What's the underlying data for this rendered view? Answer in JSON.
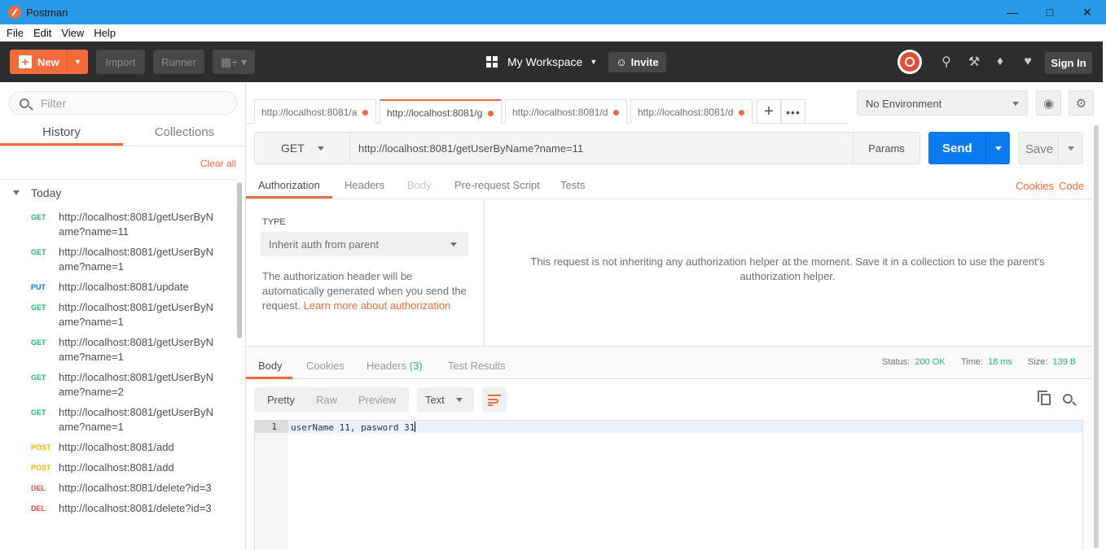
{
  "window": {
    "title": "Postman"
  },
  "menu": [
    "File",
    "Edit",
    "View",
    "Help"
  ],
  "header": {
    "new_label": "New",
    "import_label": "Import",
    "runner_label": "Runner",
    "workspace_label": "My Workspace",
    "invite_label": "Invite",
    "signin_label": "Sign In"
  },
  "sidebar": {
    "filter_placeholder": "Filter",
    "tabs": [
      "History",
      "Collections"
    ],
    "clear_all": "Clear all",
    "group_label": "Today",
    "history": [
      {
        "method": "GET",
        "url": "http://localhost:8081/getUserByName?name=11"
      },
      {
        "method": "GET",
        "url": "http://localhost:8081/getUserByName?name=1"
      },
      {
        "method": "PUT",
        "url": "http://localhost:8081/update"
      },
      {
        "method": "GET",
        "url": "http://localhost:8081/getUserByName?name=1"
      },
      {
        "method": "GET",
        "url": "http://localhost:8081/getUserByName?name=1"
      },
      {
        "method": "GET",
        "url": "http://localhost:8081/getUserByName?name=2"
      },
      {
        "method": "GET",
        "url": "http://localhost:8081/getUserByName?name=1"
      },
      {
        "method": "POST",
        "url": "http://localhost:8081/add"
      },
      {
        "method": "POST",
        "url": "http://localhost:8081/add"
      },
      {
        "method": "DEL",
        "url": "http://localhost:8081/delete?id=3"
      },
      {
        "method": "DEL",
        "url": "http://localhost:8081/delete?id=3"
      }
    ]
  },
  "tabs": [
    {
      "label": "http://localhost:8081/a"
    },
    {
      "label": "http://localhost:8081/g"
    },
    {
      "label": "http://localhost:8081/d"
    },
    {
      "label": "http://localhost:8081/d"
    }
  ],
  "environment": {
    "selected": "No Environment"
  },
  "request": {
    "method": "GET",
    "url": "http://localhost:8081/getUserByName?name=11",
    "params_label": "Params",
    "send_label": "Send",
    "save_label": "Save",
    "subtabs": [
      "Authorization",
      "Headers",
      "Body",
      "Pre-request Script",
      "Tests"
    ],
    "cookies_link": "Cookies",
    "code_link": "Code"
  },
  "auth": {
    "type_label": "TYPE",
    "type_value": "Inherit auth from parent",
    "description": "The authorization header will be automatically generated when you send the request.",
    "learn_more": "Learn more about authorization",
    "message": "This request is not inheriting any authorization helper at the moment. Save it in a collection to use the parent's authorization helper."
  },
  "response": {
    "tabs": [
      "Body",
      "Cookies",
      "Headers",
      "Test Results"
    ],
    "headers_count": "(3)",
    "status_label": "Status:",
    "status_value": "200 OK",
    "time_label": "Time:",
    "time_value": "18 ms",
    "size_label": "Size:",
    "size_value": "139 B",
    "formats": [
      "Pretty",
      "Raw",
      "Preview"
    ],
    "type_select": "Text",
    "line_number": "1",
    "body": "userName 11, pasword 31"
  },
  "colors": {
    "accent": "#f26b3a",
    "send_blue": "#097bed",
    "get": "#26b47f",
    "put": "#097bed",
    "post": "#ffb400",
    "del": "#ed4b48"
  }
}
